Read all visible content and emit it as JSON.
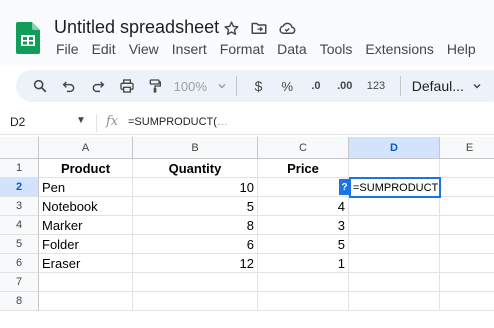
{
  "app": {
    "title": "Untitled spreadsheet",
    "brand_color": "#0f9d58",
    "title_icons": [
      "star-icon",
      "move-to-folder-icon",
      "cloud-saved-icon"
    ]
  },
  "menu": [
    "File",
    "Edit",
    "View",
    "Insert",
    "Format",
    "Data",
    "Tools",
    "Extensions",
    "Help"
  ],
  "toolbar": {
    "zoom": "100%",
    "currency": "$",
    "percent": "%",
    "decrease_decimal": ".0",
    "increase_decimal": ".00",
    "number_format": "123",
    "font": "Defaul..."
  },
  "formula_bar": {
    "name_box": "D2",
    "fx": "fx",
    "formula": "=SUMPRODUCT(",
    "hint": "…"
  },
  "columns": [
    "A",
    "B",
    "C",
    "D",
    "E"
  ],
  "selected_column": "D",
  "rows": [
    "1",
    "2",
    "3",
    "4",
    "5",
    "6",
    "7",
    "8"
  ],
  "selected_row": "2",
  "table": {
    "headers": [
      "Product",
      "Quantity",
      "Price"
    ],
    "data": [
      [
        "Pen",
        "10",
        ""
      ],
      [
        "Notebook",
        "5",
        "4"
      ],
      [
        "Marker",
        "8",
        "3"
      ],
      [
        "Folder",
        "6",
        "5"
      ],
      [
        "Eraser",
        "12",
        "1"
      ]
    ]
  },
  "active_cell": {
    "ref": "D2",
    "content": "=SUMPRODUCT(",
    "help_badge": "?"
  },
  "colors": {
    "selection": "#1a73e8",
    "header_selected_bg": "#d3e3fd"
  }
}
